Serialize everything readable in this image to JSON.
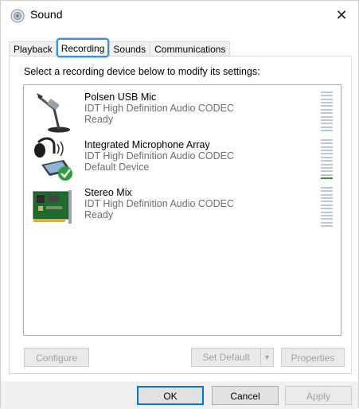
{
  "window": {
    "title": "Sound",
    "close_symbol": "✕"
  },
  "tabs": [
    {
      "label": "Playback",
      "active": false
    },
    {
      "label": "Recording",
      "active": true
    },
    {
      "label": "Sounds",
      "active": false
    },
    {
      "label": "Communications",
      "active": false
    }
  ],
  "panel": {
    "instruction": "Select a recording device below to modify its settings:"
  },
  "devices": [
    {
      "name": "Polsen USB Mic",
      "description": "IDT High Definition Audio CODEC",
      "status": "Ready",
      "icon": "microphone-stand-icon",
      "level": 0.0,
      "default": false
    },
    {
      "name": "Integrated Microphone Array",
      "description": "IDT High Definition Audio CODEC",
      "status": "Default Device",
      "icon": "laptop-headset-icon",
      "level": 0.1,
      "default": true
    },
    {
      "name": "Stereo Mix",
      "description": "IDT High Definition Audio CODEC",
      "status": "Ready",
      "icon": "sound-card-icon",
      "level": 0.0,
      "default": false
    }
  ],
  "panel_buttons": {
    "configure": "Configure",
    "set_default": "Set Default",
    "properties": "Properties"
  },
  "footer_buttons": {
    "ok": "OK",
    "cancel": "Cancel",
    "apply": "Apply"
  },
  "colors": {
    "accent": "#0078d7",
    "tab_highlight": "#3c8ee0",
    "level_on": "#3a8a3a",
    "level_off": "#b8c8d6",
    "default_check": "#2e9e3a"
  }
}
